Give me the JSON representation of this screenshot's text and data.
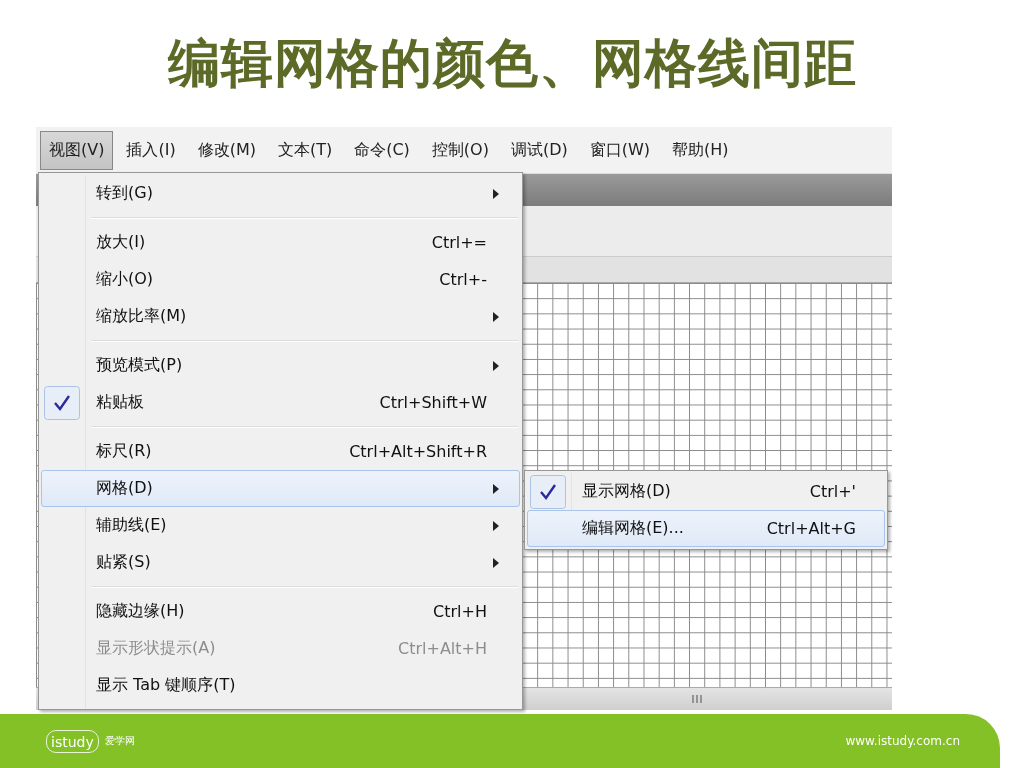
{
  "title": "编辑网格的颜色、网格线间距",
  "menubar": {
    "items": [
      {
        "label": "视图(V)",
        "selected": true
      },
      {
        "label": "插入(I)",
        "selected": false
      },
      {
        "label": "修改(M)",
        "selected": false
      },
      {
        "label": "文本(T)",
        "selected": false
      },
      {
        "label": "命令(C)",
        "selected": false
      },
      {
        "label": "控制(O)",
        "selected": false
      },
      {
        "label": "调试(D)",
        "selected": false
      },
      {
        "label": "窗口(W)",
        "selected": false
      },
      {
        "label": "帮助(H)",
        "selected": false
      }
    ]
  },
  "menu": {
    "items": [
      {
        "kind": "item",
        "label": "转到(G)",
        "submenu": true,
        "checked": false,
        "disabled": false,
        "selected": false
      },
      {
        "kind": "separator"
      },
      {
        "kind": "item",
        "label": "放大(I)",
        "shortcut": "Ctrl+=",
        "submenu": false,
        "checked": false,
        "disabled": false,
        "selected": false
      },
      {
        "kind": "item",
        "label": "缩小(O)",
        "shortcut": "Ctrl+-",
        "submenu": false,
        "checked": false,
        "disabled": false,
        "selected": false
      },
      {
        "kind": "item",
        "label": "缩放比率(M)",
        "submenu": true,
        "checked": false,
        "disabled": false,
        "selected": false
      },
      {
        "kind": "separator"
      },
      {
        "kind": "item",
        "label": "预览模式(P)",
        "submenu": true,
        "checked": false,
        "disabled": false,
        "selected": false
      },
      {
        "kind": "item",
        "label": "粘贴板",
        "shortcut": "Ctrl+Shift+W",
        "submenu": false,
        "checked": true,
        "disabled": false,
        "selected": false
      },
      {
        "kind": "separator"
      },
      {
        "kind": "item",
        "label": "标尺(R)",
        "shortcut": "Ctrl+Alt+Shift+R",
        "submenu": false,
        "checked": false,
        "disabled": false,
        "selected": false
      },
      {
        "kind": "item",
        "label": "网格(D)",
        "submenu": true,
        "checked": false,
        "disabled": false,
        "selected": true
      },
      {
        "kind": "item",
        "label": "辅助线(E)",
        "submenu": true,
        "checked": false,
        "disabled": false,
        "selected": false
      },
      {
        "kind": "item",
        "label": "贴紧(S)",
        "submenu": true,
        "checked": false,
        "disabled": false,
        "selected": false
      },
      {
        "kind": "separator"
      },
      {
        "kind": "item",
        "label": "隐藏边缘(H)",
        "shortcut": "Ctrl+H",
        "submenu": false,
        "checked": false,
        "disabled": false,
        "selected": false
      },
      {
        "kind": "item",
        "label": "显示形状提示(A)",
        "shortcut": "Ctrl+Alt+H",
        "submenu": false,
        "checked": false,
        "disabled": true,
        "selected": false
      },
      {
        "kind": "item",
        "label": "显示 Tab 键顺序(T)",
        "submenu": false,
        "checked": false,
        "disabled": false,
        "selected": false
      }
    ]
  },
  "submenu": {
    "items": [
      {
        "label": "显示网格(D)",
        "shortcut": "Ctrl+'",
        "checked": true,
        "selected": false
      },
      {
        "label": "编辑网格(E)...",
        "shortcut": "Ctrl+Alt+G",
        "checked": false,
        "selected": true
      }
    ]
  },
  "footer": {
    "logo": "istudy",
    "brand": "爱学网",
    "url": "www.istudy.com.cn"
  }
}
